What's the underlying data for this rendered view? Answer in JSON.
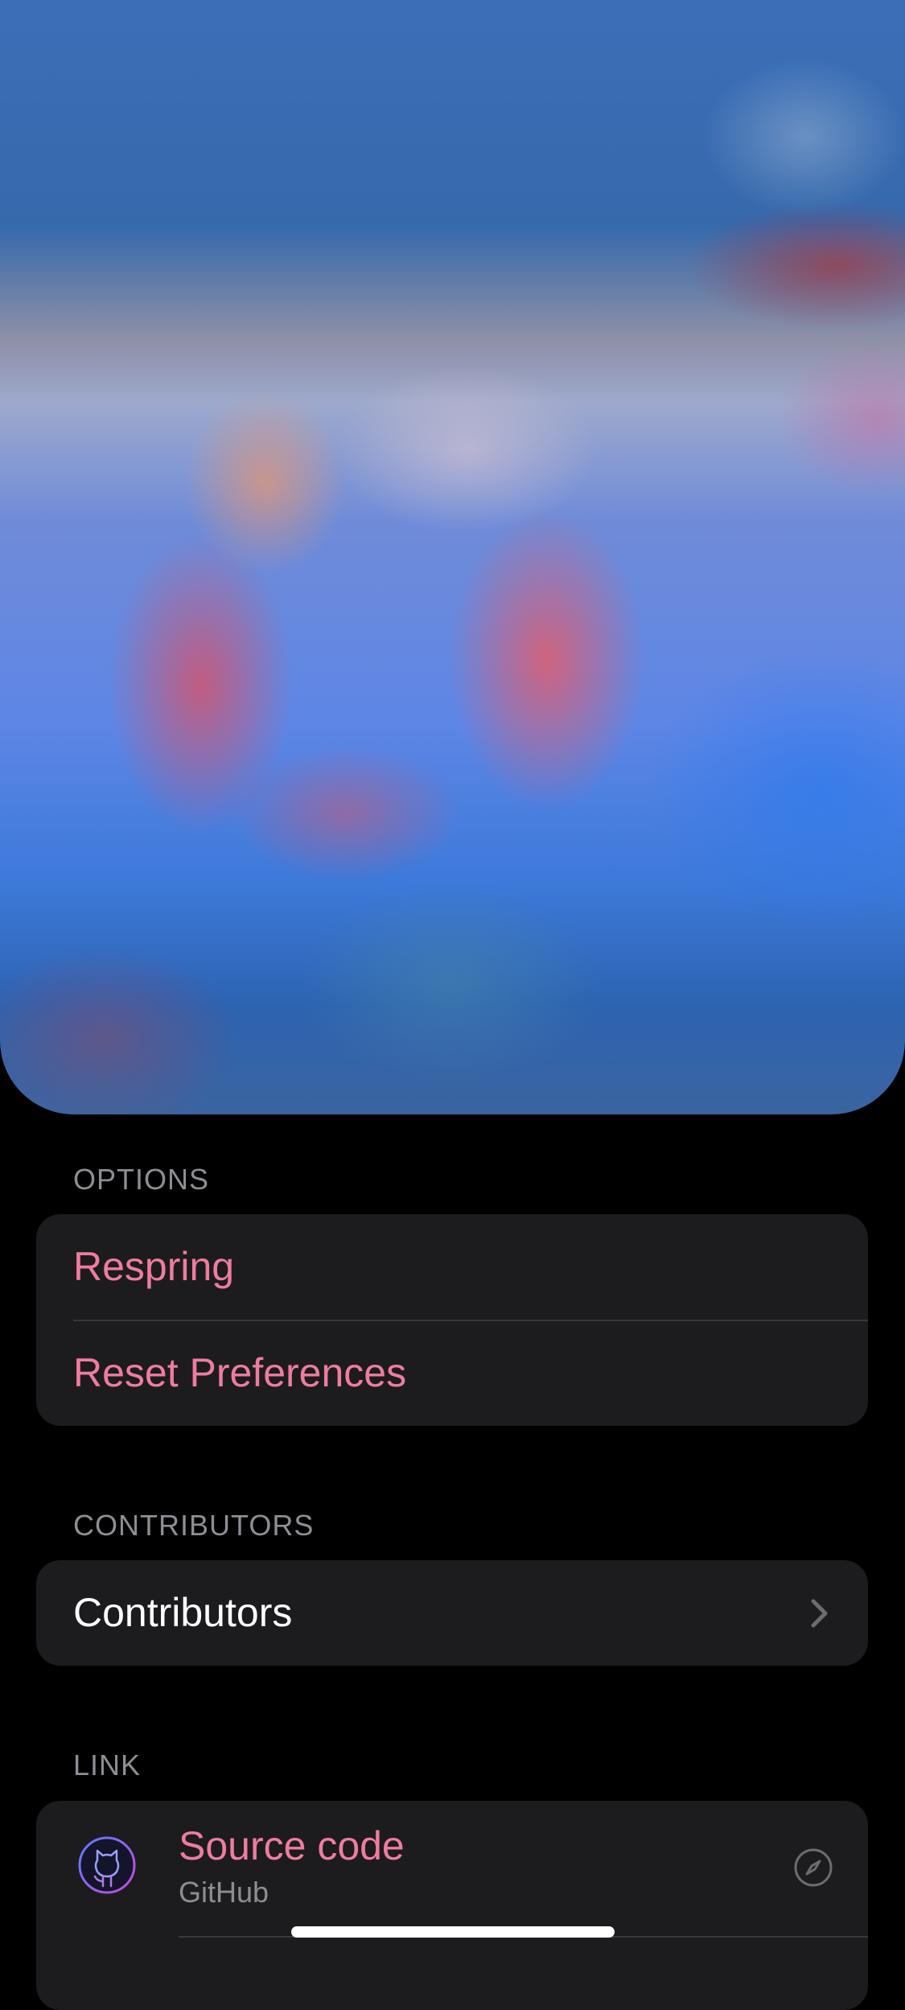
{
  "header": {
    "image_description": "blurred colorful header artwork"
  },
  "sections": {
    "options": {
      "header": "OPTIONS",
      "items": [
        {
          "label": "Respring"
        },
        {
          "label": "Reset Preferences"
        }
      ]
    },
    "contributors": {
      "header": "CONTRIBUTORS",
      "items": [
        {
          "label": "Contributors",
          "icon": "chevron-right-icon"
        }
      ]
    },
    "link": {
      "header": "LINK",
      "items": [
        {
          "title": "Source code",
          "subtitle": "GitHub",
          "icon": "github-icon",
          "action_icon": "compass-icon"
        }
      ]
    }
  },
  "colors": {
    "accent": "#ef7c9f",
    "background": "#000000",
    "card": "#1c1c1e",
    "secondary_text": "#8d8d93",
    "separator": "#38383a"
  }
}
